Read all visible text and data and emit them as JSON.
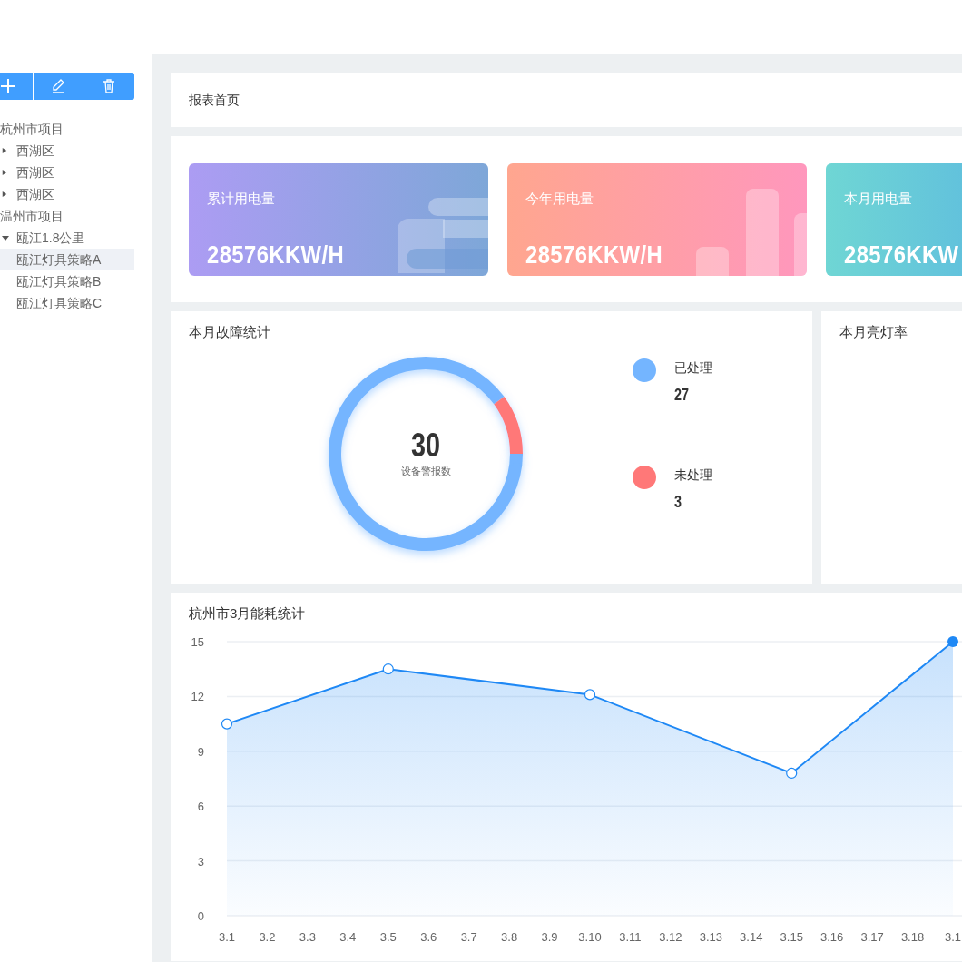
{
  "toolbar": {
    "buttons": [
      {
        "kind": "add"
      },
      {
        "kind": "edit"
      },
      {
        "kind": "delete"
      }
    ]
  },
  "tree": [
    {
      "label": "杭州市项目",
      "selected": false,
      "children": [
        {
          "label": "西湖区",
          "expanded": false,
          "selected": false
        },
        {
          "label": "西湖区",
          "expanded": false,
          "selected": false
        },
        {
          "label": "西湖区",
          "expanded": false,
          "selected": false
        }
      ]
    },
    {
      "label": "温州市项目",
      "selected": false,
      "children": [
        {
          "label": "瓯江1.8公里",
          "expanded": true,
          "selected": false,
          "children": [
            {
              "label": "瓯江灯具策略A",
              "selected": true
            },
            {
              "label": "瓯江灯具策略B",
              "selected": false
            },
            {
              "label": "瓯江灯具策略C",
              "selected": false
            }
          ]
        }
      ]
    }
  ],
  "breadcrumb": "报表首页",
  "stat_cards": [
    {
      "label": "累计用电量",
      "value": "28576KKW/H",
      "color": "#ac9cf3",
      "kind": "layers"
    },
    {
      "label": "今年用电量",
      "value": "28576KKW/H",
      "color": "#ffa68f",
      "kind": "bars"
    },
    {
      "label": "本月用电量",
      "value": "28576KKW",
      "color": "#6fd6d4",
      "kind": "plain"
    }
  ],
  "fault_panel": {
    "title": "本月故障统计",
    "total": "30",
    "total_label": "设备警报数",
    "chart_data": {
      "type": "donut",
      "categories": [
        "已处理",
        "未处理"
      ],
      "values": [
        90,
        10
      ]
    },
    "legend": [
      {
        "value": "27",
        "color": "#74b5ff"
      },
      {
        "value": "3",
        "color": "#ff7878"
      }
    ]
  },
  "light_panel": {
    "title": "本月亮灯率"
  },
  "energy_panel": {
    "title": "杭州市3月能耗统计",
    "chart_data": {
      "type": "area",
      "categories": [
        "3.1",
        "3.2",
        "3.3",
        "3.4",
        "3.5",
        "3.6",
        "3.7",
        "3.8",
        "3.9",
        "3.10",
        "3.11",
        "3.12",
        "3.13",
        "3.14",
        "3.15",
        "3.16",
        "3.17",
        "3.18",
        "3.1"
      ],
      "series": [
        {
          "color": "#1e88f5",
          "values": [
            10.5,
            null,
            null,
            null,
            13.5,
            null,
            null,
            null,
            null,
            12.1,
            null,
            null,
            null,
            null,
            7.8,
            null,
            null,
            null,
            15
          ]
        }
      ],
      "ylim": [
        0,
        15
      ],
      "yticks": [
        0,
        3,
        6,
        9,
        12,
        15
      ],
      "grid": true
    }
  }
}
